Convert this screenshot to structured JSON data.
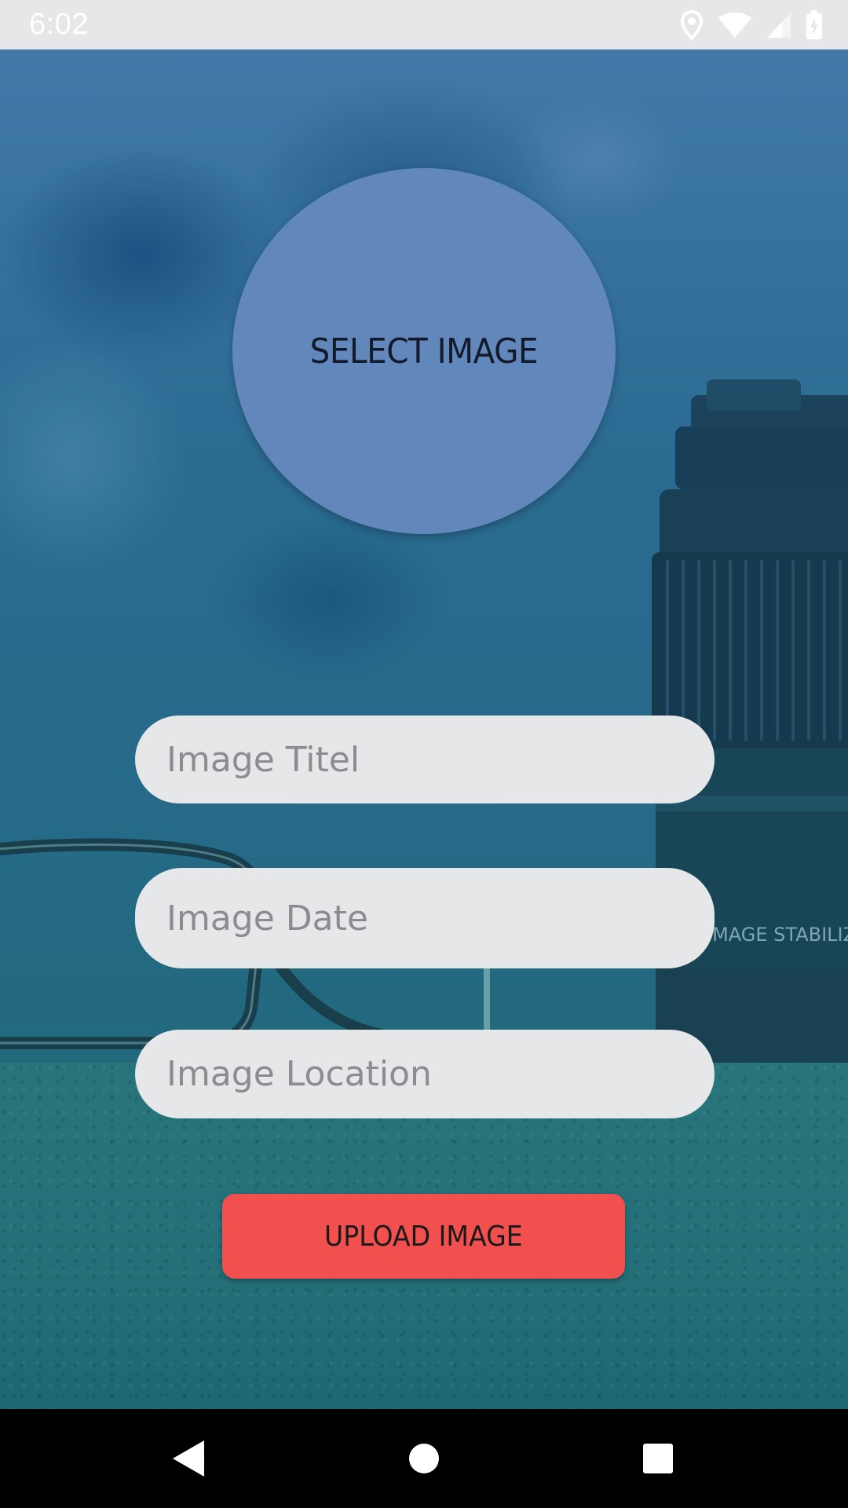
{
  "status_bar": {
    "time": "6:02",
    "icons": [
      "location-icon",
      "wifi-icon",
      "cellular-signal-icon",
      "battery-charging-icon"
    ]
  },
  "main": {
    "select_image_label": "SELECT IMAGE",
    "fields": {
      "title_placeholder": "Image Titel",
      "date_placeholder": "Image Date",
      "location_placeholder": "Image Location"
    },
    "upload_label": "UPLOAD IMAGE"
  },
  "background": {
    "lens_text": "IMAGE STABILIZER"
  },
  "navigation": {
    "icons": [
      "back-icon",
      "home-icon",
      "recents-icon"
    ]
  },
  "colors": {
    "select_circle": "#6187bb",
    "field_background": "#e6e7e9",
    "upload_button": "#f24f4f",
    "status_bar": "#e6e7e9",
    "nav_bar": "#000000"
  }
}
